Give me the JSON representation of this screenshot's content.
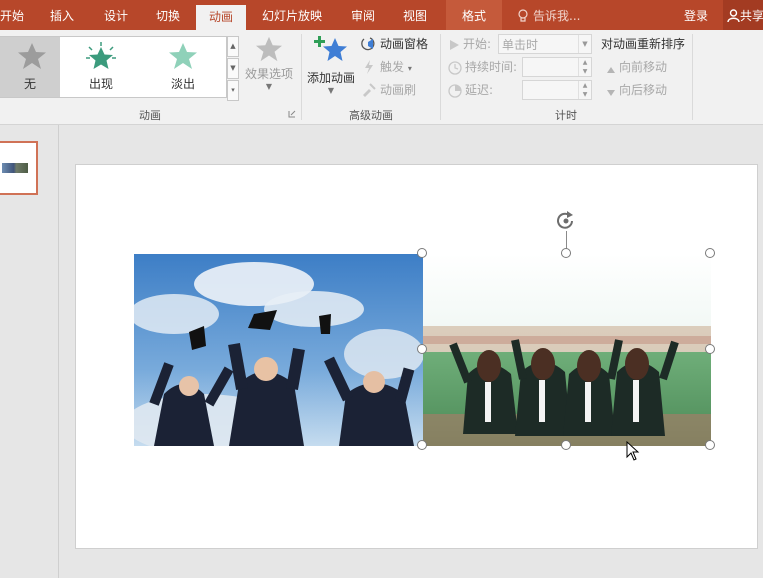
{
  "tabs": {
    "home": "开始",
    "insert": "插入",
    "design": "设计",
    "transitions": "切换",
    "animations": "动画",
    "slideshow": "幻灯片放映",
    "review": "审阅",
    "view": "视图",
    "format": "格式"
  },
  "tell_me": "告诉我...",
  "account": {
    "login": "登录",
    "share": "共享"
  },
  "colors": {
    "accent": "#b7472a",
    "format_tab": "#c55a3b"
  },
  "animation_gallery": {
    "items": [
      {
        "label": "无",
        "icon": "gray-star-icon",
        "selected": true
      },
      {
        "label": "出现",
        "icon": "green-burst-star-icon",
        "selected": false
      },
      {
        "label": "淡出",
        "icon": "green-star-icon",
        "selected": false
      }
    ],
    "effect_options": "效果选项"
  },
  "groups": {
    "animation": "动画",
    "advanced": "高级动画",
    "timing": "计时"
  },
  "advanced": {
    "add_animation": "添加动画",
    "animation_pane": "动画窗格",
    "trigger": "触发",
    "animation_painter": "动画刷"
  },
  "timing": {
    "start_label": "开始:",
    "start_value": "单击时",
    "duration_label": "持续时间:",
    "delay_label": "延迟:",
    "reorder_title": "对动画重新排序",
    "move_earlier": "向前移动",
    "move_later": "向后移动"
  },
  "slide": {
    "photos": [
      {
        "name": "graduates-throwing-caps",
        "icon": "graduation-photo-icon"
      },
      {
        "name": "graduates-seated-on-field",
        "icon": "graduation-photo-icon"
      }
    ]
  }
}
